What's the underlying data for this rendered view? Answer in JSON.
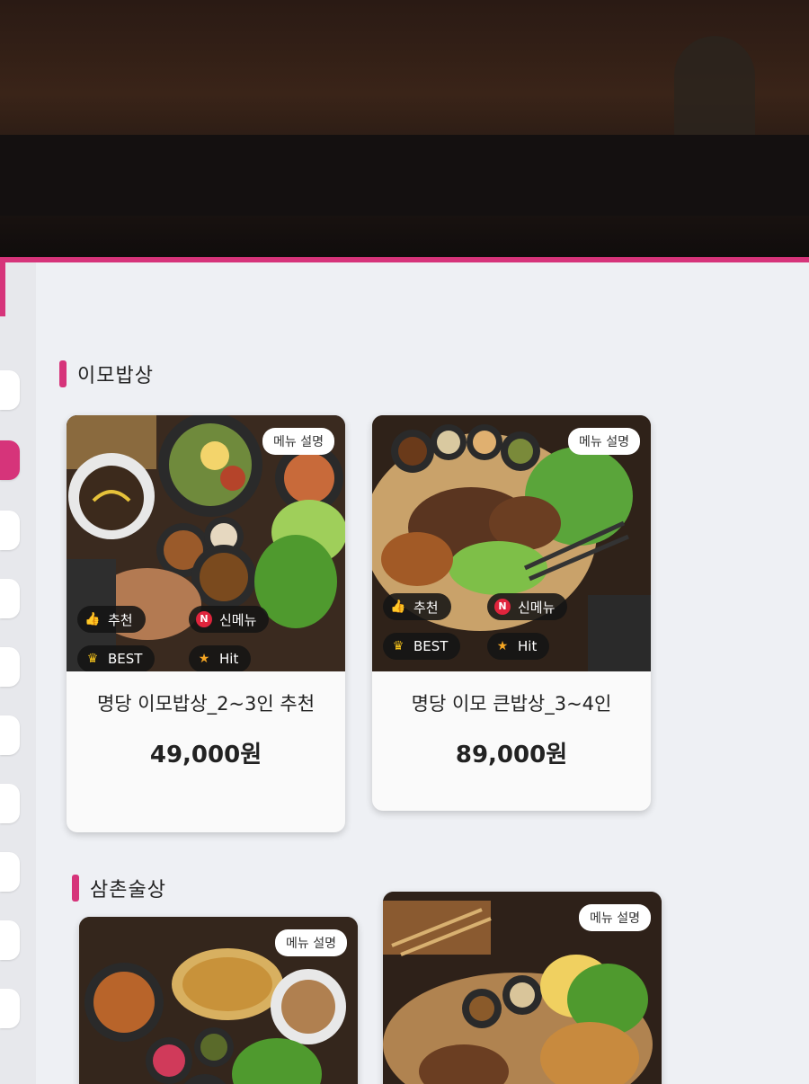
{
  "sections": [
    {
      "title": "이모밥상",
      "cards": [
        {
          "description_button": "메뉴 설명",
          "badges": [
            "추천",
            "신메뉴",
            "BEST",
            "Hit"
          ],
          "name": "명당 이모밥상_2~3인 추천",
          "price": "49,000원"
        },
        {
          "description_button": "메뉴 설명",
          "badges": [
            "추천",
            "신메뉴",
            "BEST",
            "Hit"
          ],
          "name": "명당 이모 큰밥상_3~4인",
          "price": "89,000원"
        }
      ]
    },
    {
      "title": "삼촌술상",
      "cards": [
        {
          "description_button": "메뉴 설명"
        },
        {
          "description_button": "메뉴 설명"
        }
      ]
    }
  ],
  "icons": {
    "recommend": "thumbs-up-icon",
    "new": "new-n-icon",
    "best": "crown-icon",
    "hit": "star-icon"
  },
  "colors": {
    "accent": "#d6347a",
    "badge_bg": "#141414",
    "card_bg": "#fafafa",
    "screen_bg": "#eef0f4"
  }
}
